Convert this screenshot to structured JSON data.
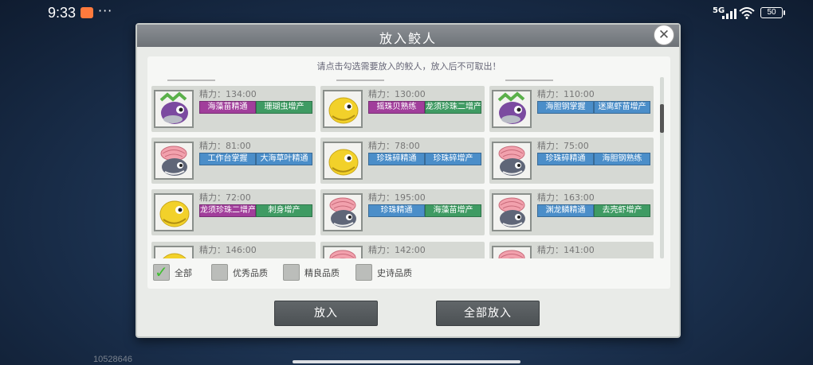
{
  "status": {
    "time": "9:33",
    "more": "···",
    "network": "5G",
    "battery": "50"
  },
  "background": {
    "score": "10528646"
  },
  "dialog": {
    "title": "放入鲛人",
    "close_icon": "close-x-icon",
    "hint": "请点击勾选需要放入的鲛人，放入后不可取出！",
    "cards": [
      {
        "stat": "精力：134:00",
        "portrait": "purple",
        "skills": [
          {
            "name": "海藻苗精通",
            "color": "#a13e9b"
          },
          {
            "name": "珊瑚虫增产",
            "color": "#3f9b63"
          }
        ]
      },
      {
        "stat": "精力：130:00",
        "portrait": "yellow",
        "skills": [
          {
            "name": "摇珠贝熟练",
            "color": "#a13e9b"
          },
          {
            "name": "龙须珍珠二增产",
            "color": "#3f9b63"
          }
        ]
      },
      {
        "stat": "精力：110:00",
        "portrait": "purple",
        "skills": [
          {
            "name": "海胆钢掌握",
            "color": "#4b8ec9"
          },
          {
            "name": "迷离虾苗增产",
            "color": "#4b8ec9"
          }
        ]
      },
      {
        "stat": "精力：81:00",
        "portrait": "pink",
        "skills": [
          {
            "name": "工作台掌握",
            "color": "#4b8ec9"
          },
          {
            "name": "大海草叶精通",
            "color": "#4b8ec9"
          }
        ]
      },
      {
        "stat": "精力：78:00",
        "portrait": "yellow",
        "skills": [
          {
            "name": "珍珠碎精通",
            "color": "#4b8ec9"
          },
          {
            "name": "珍珠碎增产",
            "color": "#4b8ec9"
          }
        ]
      },
      {
        "stat": "精力：75:00",
        "portrait": "pink",
        "skills": [
          {
            "name": "珍珠碎精通",
            "color": "#4b8ec9"
          },
          {
            "name": "海胆钢熟练",
            "color": "#4b8ec9"
          }
        ]
      },
      {
        "stat": "精力：72:00",
        "portrait": "yellow",
        "skills": [
          {
            "name": "龙须珍珠二增产",
            "color": "#a13e9b"
          },
          {
            "name": "刺身增产",
            "color": "#3f9b63"
          }
        ]
      },
      {
        "stat": "精力：195:00",
        "portrait": "pink",
        "skills": [
          {
            "name": "珍珠精通",
            "color": "#4b8ec9"
          },
          {
            "name": "海藻苗增产",
            "color": "#3f9b63"
          }
        ]
      },
      {
        "stat": "精力：163:00",
        "portrait": "pink",
        "skills": [
          {
            "name": "渊龙鳞精通",
            "color": "#4b8ec9"
          },
          {
            "name": "去壳虾增产",
            "color": "#3f9b63"
          }
        ]
      },
      {
        "stat": "精力：146:00",
        "portrait": "yellow",
        "skills": []
      },
      {
        "stat": "精力：142:00",
        "portrait": "pink",
        "skills": []
      },
      {
        "stat": "精力：141:00",
        "portrait": "pink",
        "skills": []
      }
    ],
    "filters": [
      {
        "label": "全部",
        "checked": true
      },
      {
        "label": "优秀品质",
        "checked": false
      },
      {
        "label": "精良品质",
        "checked": false
      },
      {
        "label": "史诗品质",
        "checked": false
      }
    ],
    "buttons": {
      "place": "放入",
      "place_all": "全部放入"
    }
  }
}
